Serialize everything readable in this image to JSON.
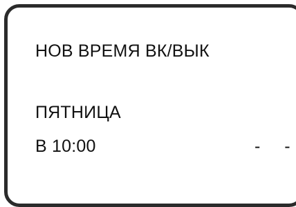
{
  "display": {
    "title": "НОВ ВРЕМЯ ВК/ВЫК",
    "day": "ПЯТНИЦА",
    "time_on": "В 10:00",
    "time_off": "- -"
  }
}
